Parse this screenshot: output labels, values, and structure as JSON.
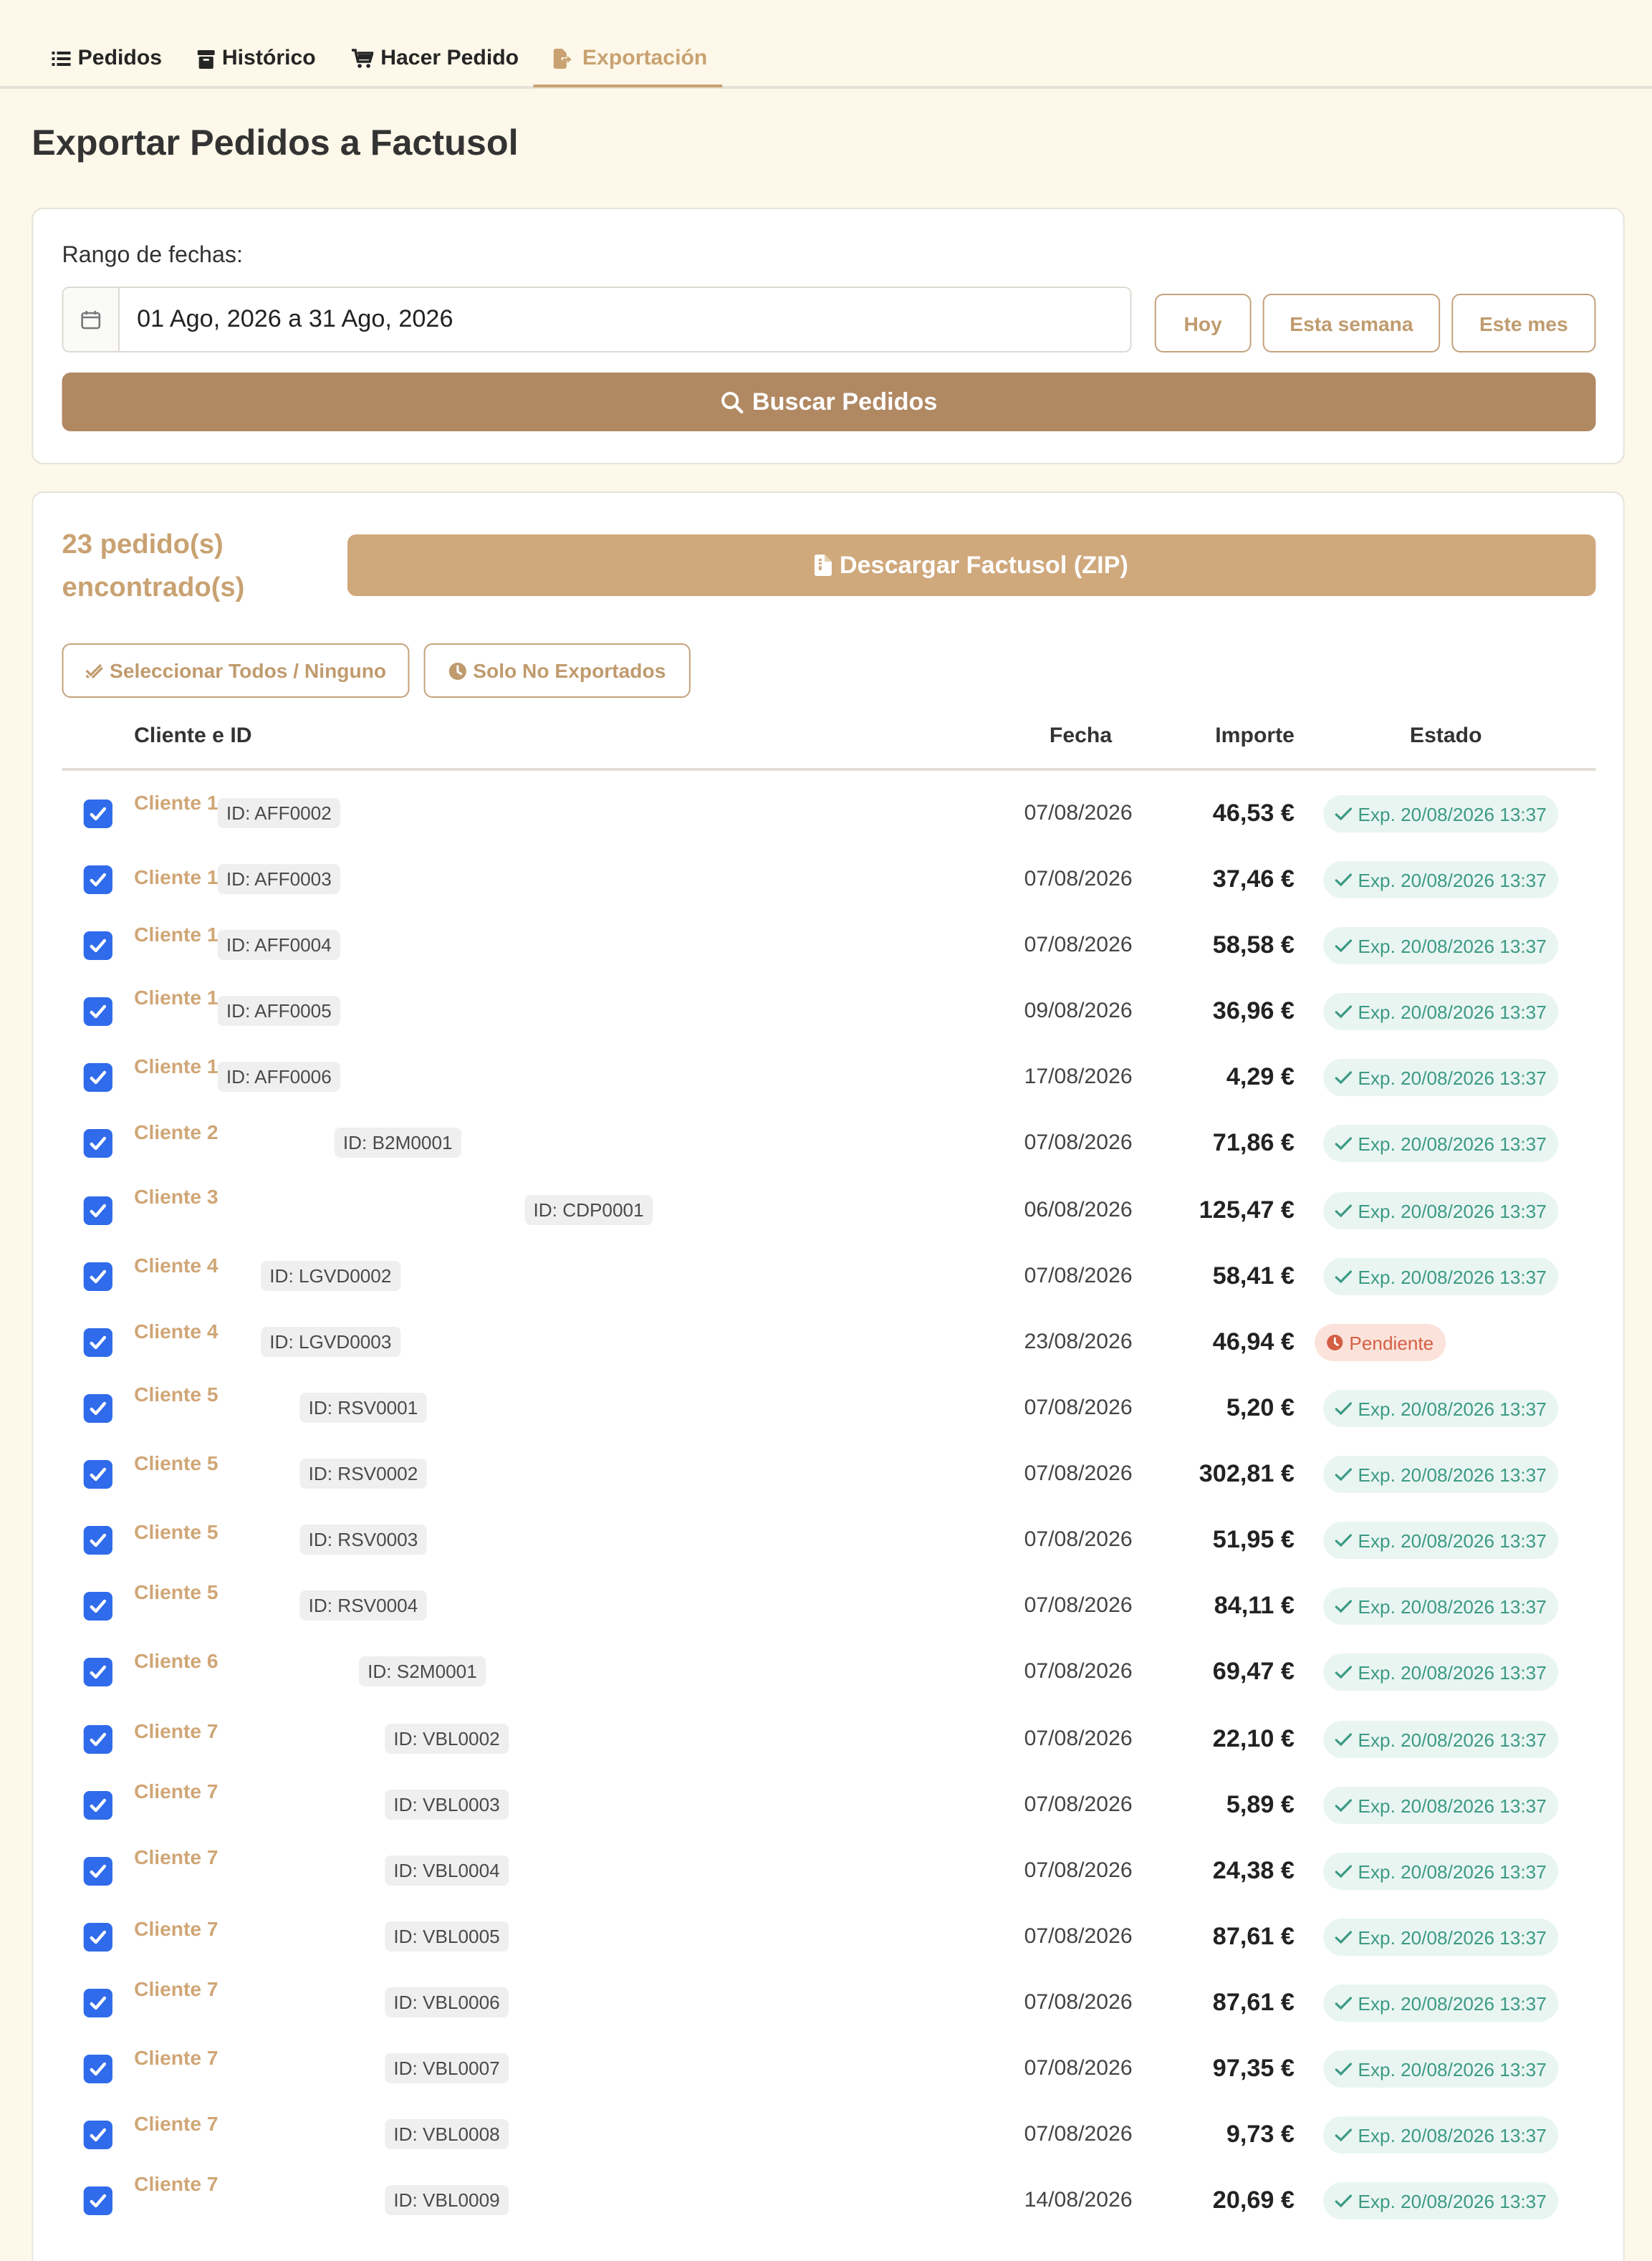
{
  "nav": {
    "tabs": [
      {
        "label": "Pedidos",
        "icon": "list-icon"
      },
      {
        "label": "Histórico",
        "icon": "archive-icon"
      },
      {
        "label": "Hacer Pedido",
        "icon": "cart-icon"
      },
      {
        "label": "Exportación",
        "icon": "file-export-icon",
        "active": true
      }
    ]
  },
  "page": {
    "title": "Exportar Pedidos a Factusol"
  },
  "filters": {
    "range_label": "Rango de fechas:",
    "date_range_value": "01 Ago, 2026 a 31 Ago, 2026",
    "quick": {
      "today": "Hoy",
      "week": "Esta semana",
      "month": "Este mes"
    },
    "search_label": "Buscar Pedidos"
  },
  "results": {
    "count_text": "23 pedido(s) encontrado(s)",
    "download_label": "Descargar Factusol (ZIP)",
    "select_all_label": "Seleccionar Todos / Ninguno",
    "only_unexported_label": "Solo No Exportados"
  },
  "table": {
    "headers": {
      "client": "Cliente e ID",
      "date": "Fecha",
      "amount": "Importe",
      "status": "Estado"
    },
    "rows": [
      {
        "client": "Cliente 1",
        "id": "ID: AFF0002",
        "date": "07/08/2026",
        "amount": "46,53 €",
        "status": "Exp. 20/08/2026 13:37",
        "exported": true
      },
      {
        "client": "Cliente 1",
        "id": "ID: AFF0003",
        "date": "07/08/2026",
        "amount": "37,46 €",
        "status": "Exp. 20/08/2026 13:37",
        "exported": true
      },
      {
        "client": "Cliente 1",
        "id": "ID: AFF0004",
        "date": "07/08/2026",
        "amount": "58,58 €",
        "status": "Exp. 20/08/2026 13:37",
        "exported": true
      },
      {
        "client": "Cliente 1",
        "id": "ID: AFF0005",
        "date": "09/08/2026",
        "amount": "36,96 €",
        "status": "Exp. 20/08/2026 13:37",
        "exported": true
      },
      {
        "client": "Cliente 1",
        "id": "ID: AFF0006",
        "date": "17/08/2026",
        "amount": "4,29 €",
        "status": "Exp. 20/08/2026 13:37",
        "exported": true
      },
      {
        "client": "Cliente 2",
        "id": "ID: B2M0001",
        "date": "07/08/2026",
        "amount": "71,86 €",
        "status": "Exp. 20/08/2026 13:37",
        "exported": true
      },
      {
        "client": "Cliente 3",
        "id": "ID: CDP0001",
        "date": "06/08/2026",
        "amount": "125,47 €",
        "status": "Exp. 20/08/2026 13:37",
        "exported": true
      },
      {
        "client": "Cliente 4",
        "id": "ID: LGVD0002",
        "date": "07/08/2026",
        "amount": "58,41 €",
        "status": "Exp. 20/08/2026 13:37",
        "exported": true
      },
      {
        "client": "Cliente 4",
        "id": "ID: LGVD0003",
        "date": "23/08/2026",
        "amount": "46,94 €",
        "status": "Pendiente",
        "exported": false
      },
      {
        "client": "Cliente 5",
        "id": "ID: RSV0001",
        "date": "07/08/2026",
        "amount": "5,20 €",
        "status": "Exp. 20/08/2026 13:37",
        "exported": true
      },
      {
        "client": "Cliente 5",
        "id": "ID: RSV0002",
        "date": "07/08/2026",
        "amount": "302,81 €",
        "status": "Exp. 20/08/2026 13:37",
        "exported": true
      },
      {
        "client": "Cliente 5",
        "id": "ID: RSV0003",
        "date": "07/08/2026",
        "amount": "51,95 €",
        "status": "Exp. 20/08/2026 13:37",
        "exported": true
      },
      {
        "client": "Cliente 5",
        "id": "ID: RSV0004",
        "date": "07/08/2026",
        "amount": "84,11 €",
        "status": "Exp. 20/08/2026 13:37",
        "exported": true
      },
      {
        "client": "Cliente 6",
        "id": "ID: S2M0001",
        "date": "07/08/2026",
        "amount": "69,47 €",
        "status": "Exp. 20/08/2026 13:37",
        "exported": true
      },
      {
        "client": "Cliente 7",
        "id": "ID: VBL0002",
        "date": "07/08/2026",
        "amount": "22,10 €",
        "status": "Exp. 20/08/2026 13:37",
        "exported": true
      },
      {
        "client": "Cliente 7",
        "id": "ID: VBL0003",
        "date": "07/08/2026",
        "amount": "5,89 €",
        "status": "Exp. 20/08/2026 13:37",
        "exported": true
      },
      {
        "client": "Cliente 7",
        "id": "ID: VBL0004",
        "date": "07/08/2026",
        "amount": "24,38 €",
        "status": "Exp. 20/08/2026 13:37",
        "exported": true
      },
      {
        "client": "Cliente 7",
        "id": "ID: VBL0005",
        "date": "07/08/2026",
        "amount": "87,61 €",
        "status": "Exp. 20/08/2026 13:37",
        "exported": true
      },
      {
        "client": "Cliente 7",
        "id": "ID: VBL0006",
        "date": "07/08/2026",
        "amount": "87,61 €",
        "status": "Exp. 20/08/2026 13:37",
        "exported": true
      },
      {
        "client": "Cliente 7",
        "id": "ID: VBL0007",
        "date": "07/08/2026",
        "amount": "97,35 €",
        "status": "Exp. 20/08/2026 13:37",
        "exported": true
      },
      {
        "client": "Cliente 7",
        "id": "ID: VBL0008",
        "date": "07/08/2026",
        "amount": "9,73 €",
        "status": "Exp. 20/08/2026 13:37",
        "exported": true
      },
      {
        "client": "Cliente 7",
        "id": "ID: VBL0009",
        "date": "14/08/2026",
        "amount": "20,69 €",
        "status": "Exp. 20/08/2026 13:37",
        "exported": true
      }
    ]
  },
  "colors": {
    "background": "#fdf8e9",
    "accent": "#c9a272",
    "primary_button": "#b08862",
    "download_button": "#cfa87c",
    "checkbox": "#2f6bea",
    "exported_text": "#3c9a84",
    "exported_bg": "#e9f5f1",
    "pending_text": "#d45f44",
    "pending_bg": "#fbe3db"
  }
}
